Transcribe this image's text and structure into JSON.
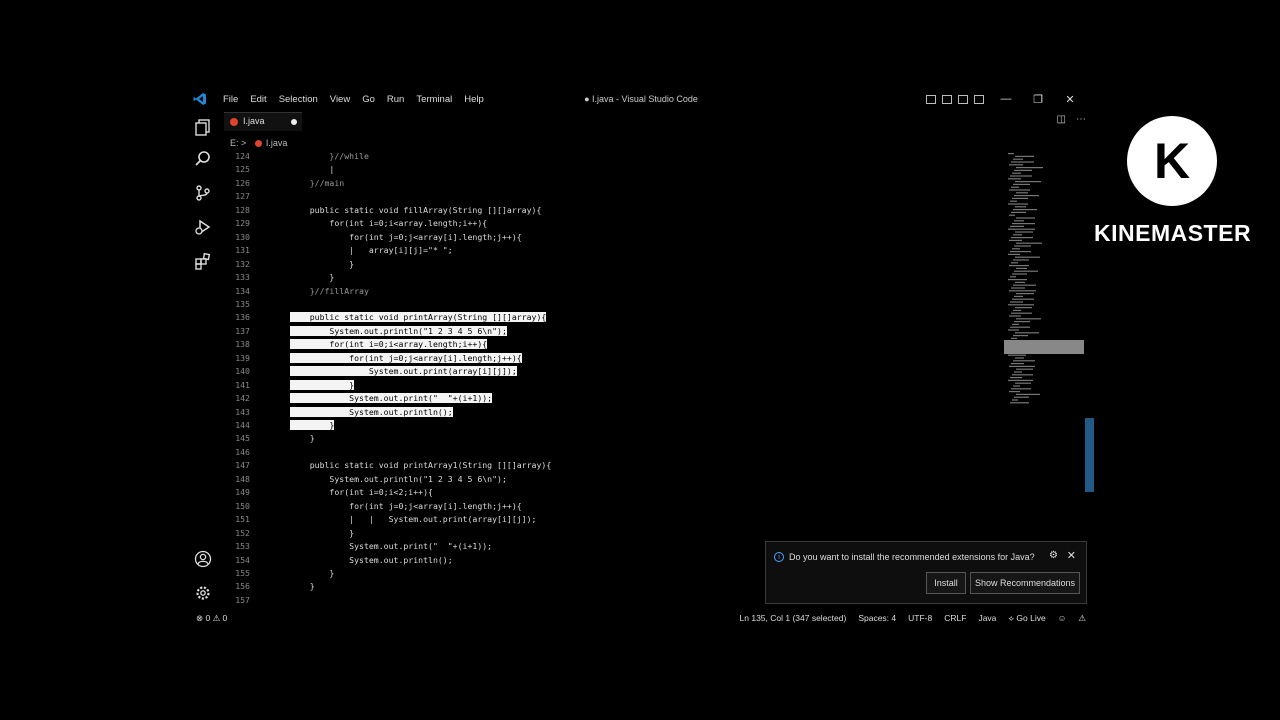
{
  "app": {
    "window_title": "● I.java - Visual Studio Code",
    "menu": [
      "File",
      "Edit",
      "Selection",
      "View",
      "Go",
      "Run",
      "Terminal",
      "Help"
    ]
  },
  "tab": {
    "label": "I.java"
  },
  "breadcrumb": {
    "drive": "E:",
    "sep": ">",
    "file": "I.java"
  },
  "editor": {
    "lines": [
      {
        "n": "124",
        "t": "        }//while"
      },
      {
        "n": "125",
        "t": "        |"
      },
      {
        "n": "126",
        "t": "    }//main"
      },
      {
        "n": "127",
        "t": ""
      },
      {
        "n": "128",
        "t": "    public static void fillArray(String [][]array){"
      },
      {
        "n": "129",
        "t": "        for(int i=0;i<array.length;i++){"
      },
      {
        "n": "130",
        "t": "            for(int j=0;j<array[i].length;j++){"
      },
      {
        "n": "131",
        "t": "            |   array[i][j]=\"* \";"
      },
      {
        "n": "132",
        "t": "            }"
      },
      {
        "n": "133",
        "t": "        }"
      },
      {
        "n": "134",
        "t": "    }//fillArray"
      },
      {
        "n": "135",
        "t": ""
      },
      {
        "n": "136",
        "t": "    public static void printArray(String [][]array){"
      },
      {
        "n": "137",
        "t": "        System.out.println(\"1 2 3 4 5 6\\n\");"
      },
      {
        "n": "138",
        "t": "        for(int i=0;i<array.length;i++){"
      },
      {
        "n": "139",
        "t": "            for(int j=0;j<array[i].length;j++){"
      },
      {
        "n": "140",
        "t": "                System.out.print(array[i][j]);"
      },
      {
        "n": "141",
        "t": "            }"
      },
      {
        "n": "142",
        "t": "            System.out.print(\"  \"+(i+1));"
      },
      {
        "n": "143",
        "t": "            System.out.println();"
      },
      {
        "n": "144",
        "t": "        }"
      },
      {
        "n": "145",
        "t": "    }"
      },
      {
        "n": "146",
        "t": ""
      },
      {
        "n": "147",
        "t": "    public static void printArray1(String [][]array){"
      },
      {
        "n": "148",
        "t": "        System.out.println(\"1 2 3 4 5 6\\n\");"
      },
      {
        "n": "149",
        "t": "        for(int i=0;i<2;i++){"
      },
      {
        "n": "150",
        "t": "            for(int j=0;j<array[i].length;j++){"
      },
      {
        "n": "151",
        "t": "            |   |   System.out.print(array[i][j]);"
      },
      {
        "n": "152",
        "t": "            }"
      },
      {
        "n": "153",
        "t": "            System.out.print(\"  \"+(i+1));"
      },
      {
        "n": "154",
        "t": "            System.out.println();"
      },
      {
        "n": "155",
        "t": "        }"
      },
      {
        "n": "156",
        "t": "    }"
      },
      {
        "n": "157",
        "t": ""
      }
    ]
  },
  "status": {
    "left": "⊗ 0 ⚠ 0",
    "position": "Ln 135, Col 1 (347 selected)",
    "spaces": "Spaces: 4",
    "encoding": "UTF-8",
    "eol": "CRLF",
    "language": "Java",
    "golive": "Go Live"
  },
  "notification": {
    "message": "Do you want to install the recommended extensions for Java?",
    "install": "Install",
    "show": "Show Recommendations"
  },
  "watermark": {
    "brand": "KINEMASTER",
    "logo_letter": "K"
  },
  "colors": {
    "selection": "#f4f4f4",
    "accent": "#2a6fa8",
    "file_icon": "#e0442a"
  }
}
